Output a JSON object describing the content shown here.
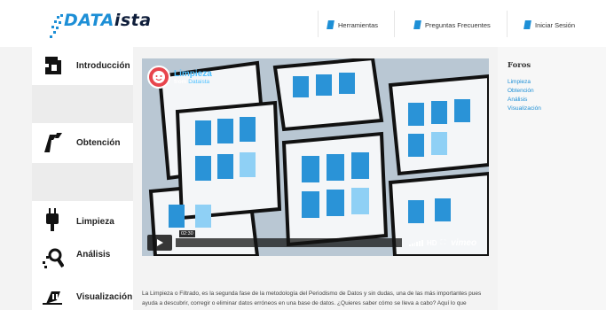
{
  "logo": {
    "part1": "DATA",
    "part2": "ista"
  },
  "nav": [
    {
      "label": "Herramientas"
    },
    {
      "label": "Preguntas Frecuentes"
    },
    {
      "label": "Iniciar Sesión"
    }
  ],
  "sidebar": {
    "items": [
      {
        "label": "Introducción",
        "icon": "intro-icon"
      },
      {
        "label": "Obtención",
        "icon": "pencil-icon"
      },
      {
        "label": "Limpieza",
        "icon": "plug-icon"
      },
      {
        "label": "Análisis",
        "icon": "magnifier-icon"
      },
      {
        "label": "Visualización",
        "icon": "chart-icon"
      }
    ]
  },
  "video": {
    "title": "Limpieza",
    "from_prefix": "from",
    "from_author": "Dataista",
    "time": "02:30",
    "hd": "HD",
    "brand": "vimeo"
  },
  "forum": {
    "title": "Foros",
    "links": [
      "Limpieza",
      "Obtención",
      "Análisis",
      "Visualización"
    ]
  },
  "description": "La Limpieza o Filtrado, es la segunda fase de la metodología del Periodismo de Datos y sin dudas, una de las más importantes pues ayuda a descubrir, corregir o eliminar datos erróneos en una base de datos. ¿Quieres saber cómo se lleva a cabo? Aquí lo que",
  "colors": {
    "accent": "#1d8fd6",
    "dark": "#0e1d3a",
    "avatar": "#e8454d"
  }
}
